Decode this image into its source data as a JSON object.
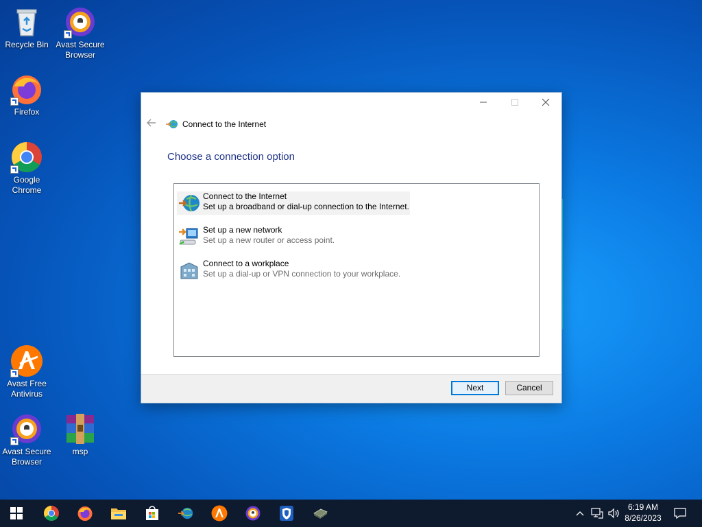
{
  "desktop": {
    "icons": [
      {
        "label": "Recycle Bin"
      },
      {
        "label": "Avast Secure Browser"
      },
      {
        "label": "Firefox"
      },
      {
        "label": "Google Chrome"
      },
      {
        "label": "Avast Free Antivirus"
      },
      {
        "label": "Avast Secure Browser"
      },
      {
        "label": "msp"
      }
    ]
  },
  "dialog": {
    "title": "Connect to the Internet",
    "heading": "Choose a connection option",
    "options": [
      {
        "title": "Connect to the Internet",
        "description": "Set up a broadband or dial-up connection to the Internet.",
        "icon": "globe-network-icon"
      },
      {
        "title": "Set up a new network",
        "description": "Set up a new router or access point.",
        "icon": "router-icon"
      },
      {
        "title": "Connect to a workplace",
        "description": "Set up a dial-up or VPN connection to your workplace.",
        "icon": "workplace-icon"
      }
    ],
    "next_label": "Next",
    "cancel_label": "Cancel"
  },
  "taskbar": {
    "clock_time": "6:19 AM",
    "clock_date": "8/26/2023"
  },
  "colors": {
    "accent": "#0078d7",
    "heading": "#1e3287",
    "taskbar": "#0e1a2e"
  }
}
